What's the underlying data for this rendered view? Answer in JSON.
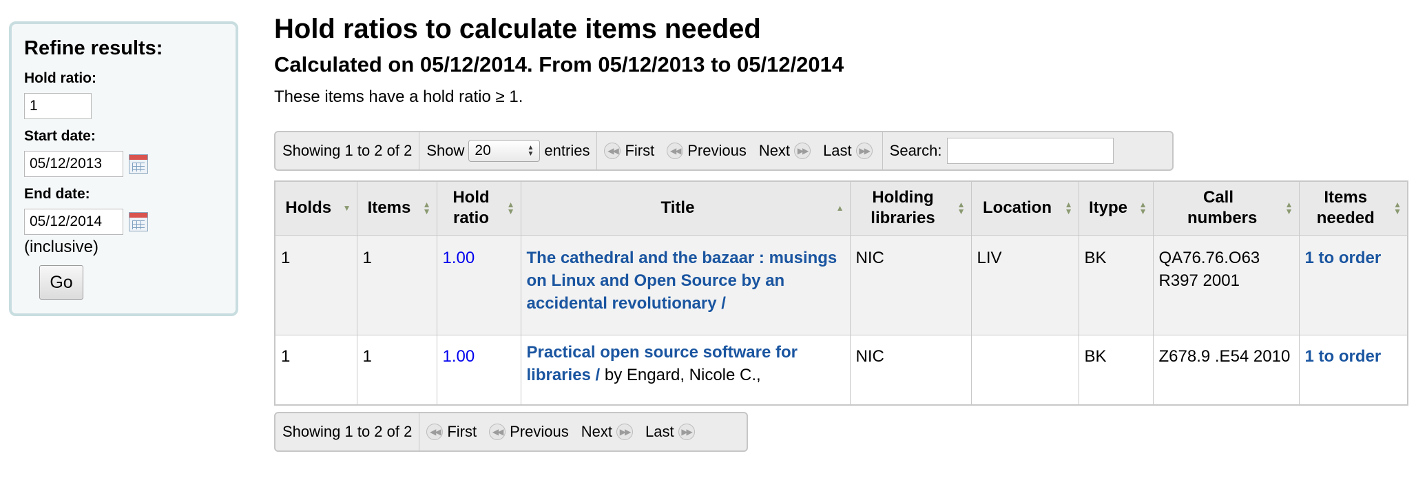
{
  "sidebar": {
    "title": "Refine results:",
    "hold_ratio_label": "Hold ratio:",
    "hold_ratio_value": "1",
    "start_date_label": "Start date:",
    "start_date_value": "05/12/2013",
    "end_date_label": "End date:",
    "end_date_value": "05/12/2014",
    "inclusive_label": "(inclusive)",
    "go_button": "Go"
  },
  "page": {
    "title": "Hold ratios to calculate items needed",
    "subtitle": "Calculated on 05/12/2014. From 05/12/2013 to 05/12/2014",
    "intro": "These items have a hold ratio ≥ 1."
  },
  "toolbar_top": {
    "info": "Showing 1 to 2 of 2",
    "show_label": "Show",
    "page_size": "20",
    "entries_label": "entries",
    "first": "First",
    "previous": "Previous",
    "next": "Next",
    "last": "Last",
    "search_label": "Search:",
    "search_value": ""
  },
  "toolbar_bottom": {
    "info": "Showing 1 to 2 of 2",
    "first": "First",
    "previous": "Previous",
    "next": "Next",
    "last": "Last"
  },
  "table": {
    "headers": [
      "Holds",
      "Items",
      "Hold ratio",
      "Title",
      "Holding libraries",
      "Location",
      "Itype",
      "Call numbers",
      "Items needed"
    ],
    "rows": [
      {
        "holds": "1",
        "items": "1",
        "hold_ratio": "1.00",
        "title": "The cathedral and the bazaar : musings on Linux and Open Source by an accidental revolutionary /",
        "author": "",
        "libraries": "NIC",
        "location": "LIV",
        "itype": "BK",
        "call_numbers": "QA76.76.O63 R397 2001",
        "items_needed": "1 to order"
      },
      {
        "holds": "1",
        "items": "1",
        "hold_ratio": "1.00",
        "title": "Practical open source software for libraries /",
        "author": "by Engard, Nicole C.,",
        "libraries": "NIC",
        "location": "",
        "itype": "BK",
        "call_numbers": "Z678.9 .E54 2010",
        "items_needed": "1 to order"
      }
    ]
  },
  "colors": {
    "link": "#1a55a0",
    "ratio_link": "#0000ee",
    "sidebar_border": "#c8dde0",
    "header_bg": "#e9e9e9",
    "sort_arrow": "#8a9970"
  }
}
